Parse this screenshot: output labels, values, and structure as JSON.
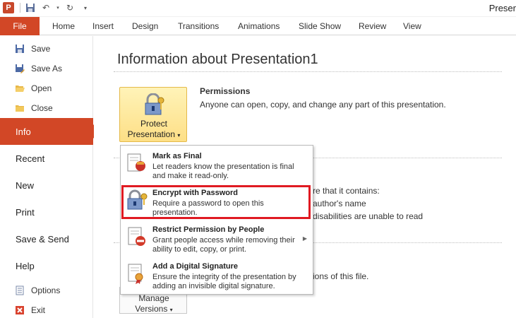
{
  "window": {
    "title": "Preser"
  },
  "tabs": {
    "file": "File",
    "items": [
      "Home",
      "Insert",
      "Design",
      "Transitions",
      "Animations",
      "Slide Show",
      "Review",
      "View"
    ]
  },
  "nav": {
    "small_top": [
      "Save",
      "Save As",
      "Open",
      "Close"
    ],
    "active": "Info",
    "big": [
      "Recent",
      "New",
      "Print",
      "Save & Send",
      "Help"
    ],
    "small_bottom": [
      "Options",
      "Exit"
    ]
  },
  "main": {
    "title": "Information about Presentation1",
    "protect_btn": {
      "line1": "Protect",
      "line2": "Presentation"
    },
    "permissions": {
      "title": "Permissions",
      "desc": "Anyone can open, copy, and change any part of this presentation."
    },
    "partial_texts": [
      "re that it contains:",
      "author's name",
      "disabilities are unable to read",
      "ions of this file."
    ],
    "versions_btn": {
      "line1": "Manage",
      "line2": "Versions"
    }
  },
  "menu": {
    "items": [
      {
        "title": "Mark as Final",
        "desc": "Let readers know the presentation is final and make it read-only."
      },
      {
        "title": "Encrypt with Password",
        "desc": "Require a password to open this presentation."
      },
      {
        "title": "Restrict Permission by People",
        "desc": "Grant people access while removing their ability to edit, copy, or print."
      },
      {
        "title": "Add a Digital Signature",
        "desc": "Ensure the integrity of the presentation by adding an invisible digital signature."
      }
    ]
  },
  "colors": {
    "accent": "#d24726",
    "highlight_border": "#e01a22"
  }
}
